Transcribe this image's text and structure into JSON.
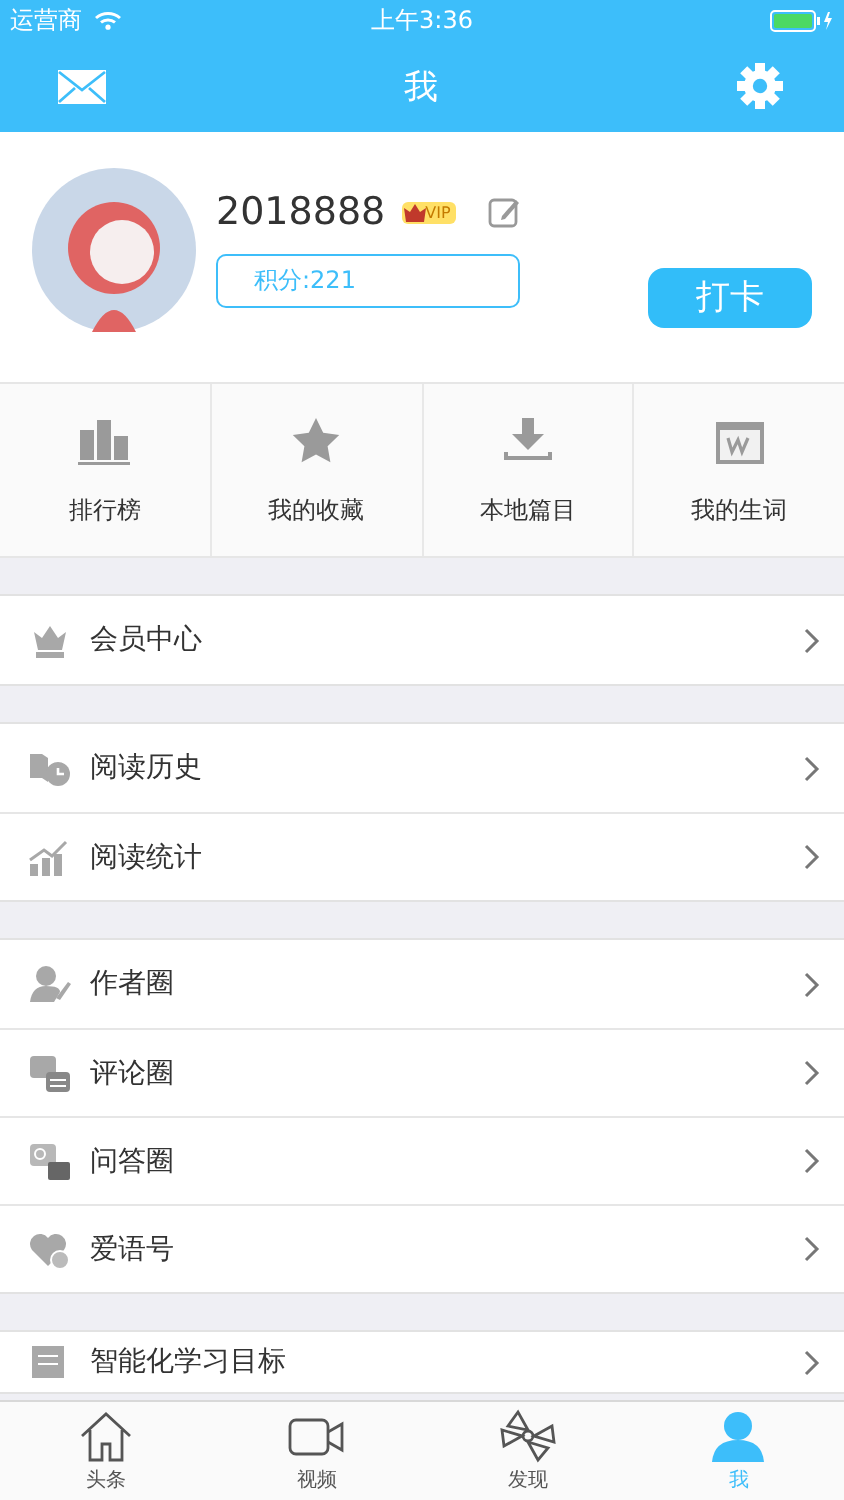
{
  "status_bar": {
    "carrier": "运营商",
    "time": "上午3:36"
  },
  "nav": {
    "title": "我"
  },
  "profile": {
    "username": "2018888",
    "badge": "VIP",
    "points": "积分:221",
    "checkin": "打卡"
  },
  "shortcuts": [
    {
      "kind": "podium",
      "label": "排行榜"
    },
    {
      "kind": "star",
      "label": "我的收藏"
    },
    {
      "kind": "download",
      "label": "本地篇目"
    },
    {
      "kind": "calendar",
      "label": "我的生词"
    }
  ],
  "sections": [
    [
      {
        "kind": "crown",
        "label": "会员中心"
      }
    ],
    [
      {
        "kind": "book",
        "label": "阅读历史"
      },
      {
        "kind": "chart",
        "label": "阅读统计"
      }
    ],
    [
      {
        "kind": "person",
        "label": "作者圈"
      },
      {
        "kind": "comment",
        "label": "评论圈"
      },
      {
        "kind": "qa",
        "label": "问答圈"
      },
      {
        "kind": "heart",
        "label": "爱语号"
      }
    ],
    [
      {
        "kind": "list",
        "label": "智能化学习目标"
      }
    ]
  ],
  "tab_bar": [
    {
      "kind": "home",
      "label": "头条",
      "selected": false
    },
    {
      "kind": "video",
      "label": "视频",
      "selected": false
    },
    {
      "kind": "pinwheel",
      "label": "发现",
      "selected": false
    },
    {
      "kind": "user",
      "label": "我",
      "selected": true
    }
  ]
}
